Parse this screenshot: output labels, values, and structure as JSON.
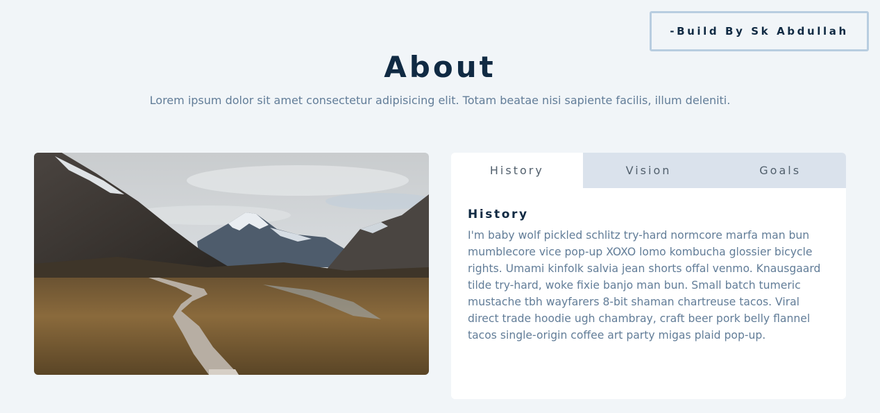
{
  "credit": {
    "label": "-Build By Sk Abdullah"
  },
  "header": {
    "title": "About",
    "subtitle": "Lorem ipsum dolor sit amet consectetur adipisicing elit. Totam beatae nisi sapiente facilis, illum deleniti."
  },
  "tabs": [
    {
      "label": "History",
      "active": true
    },
    {
      "label": "Vision",
      "active": false
    },
    {
      "label": "Goals",
      "active": false
    }
  ],
  "content": {
    "title": "History",
    "text": "I'm baby wolf pickled schlitz try-hard normcore marfa man bun mumblecore vice pop-up XOXO lomo kombucha glossier bicycle rights. Umami kinfolk salvia jean shorts offal venmo. Knausgaard tilde try-hard, woke fixie banjo man bun. Small batch tumeric mustache tbh wayfarers 8-bit shaman chartreuse tacos. Viral direct trade hoodie ugh chambray, craft beer pork belly flannel tacos single-origin coffee art party migas plaid pop-up."
  },
  "colors": {
    "background": "#f1f5f8",
    "heading": "#102a43",
    "body_text": "#627d98",
    "tab_inactive": "#dae2ec",
    "credit_border": "#b8cde0"
  }
}
